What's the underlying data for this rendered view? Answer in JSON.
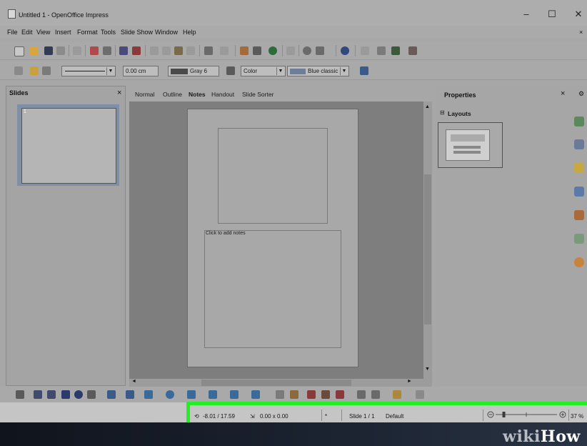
{
  "window": {
    "title": "Untitled 1 - OpenOffice Impress",
    "minimize": "–",
    "maximize": "☐",
    "close": "✕"
  },
  "menu": [
    "File",
    "Edit",
    "View",
    "Insert",
    "Format",
    "Tools",
    "Slide Show",
    "Window",
    "Help"
  ],
  "menu_close": "×",
  "format_toolbar": {
    "line_width": "0.00 cm",
    "fill_color": "Gray 6",
    "area_style": "Color",
    "color_name": "Blue classic"
  },
  "slides_pane": {
    "title": "Slides",
    "close": "×",
    "slide_number": "1"
  },
  "view_tabs": [
    "Normal",
    "Outline",
    "Notes",
    "Handout",
    "Slide Sorter"
  ],
  "active_tab": "Notes",
  "notes_placeholder": "Click to add notes",
  "properties": {
    "title": "Properties",
    "close": "×",
    "section": "Layouts",
    "section_toggle": "⊟"
  },
  "status": {
    "position": "-8.01 / 17.59",
    "size": "0.00 x 0.00",
    "slide": "Slide 1 / 1",
    "master": "Default",
    "zoom": "37 %",
    "zoom_fraction": 0.37
  },
  "watermark": {
    "wiki": "wiki",
    "how": "How"
  },
  "colors": {
    "highlight": "#22f022",
    "selected_thumb": "#7f8fa8",
    "dim_bg": "#a7a7a7"
  },
  "icons": {
    "scroll_up": "▲",
    "scroll_down": "▼",
    "scroll_left": "◄",
    "scroll_right": "►"
  }
}
